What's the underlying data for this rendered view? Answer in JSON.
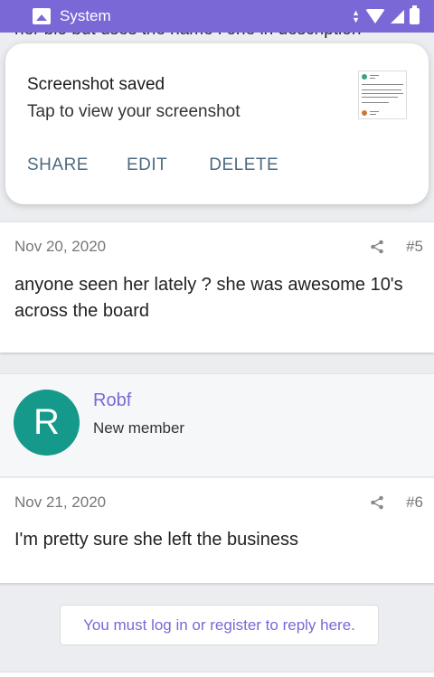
{
  "status_bar": {
    "app_name": "System",
    "icons": [
      "image-icon",
      "data-arrows-icon",
      "wifi-icon",
      "signal-icon",
      "battery-icon"
    ]
  },
  "clipped_text": "her bio but uses the name i one in description",
  "notification": {
    "title": "Screenshot saved",
    "subtitle": "Tap to view your screenshot",
    "actions": {
      "share": "SHARE",
      "edit": "EDIT",
      "delete": "DELETE"
    }
  },
  "posts": [
    {
      "date": "Nov 20, 2020",
      "number": "#5",
      "body": "anyone seen her lately ? she was awesome 10's across the board"
    },
    {
      "date": "Nov 21, 2020",
      "number": "#6",
      "body": "I'm pretty sure she left the business"
    }
  ],
  "member": {
    "avatar_letter": "R",
    "name": "Robf",
    "role": "New member"
  },
  "reply_prompt": "You must log in or register to reply here.",
  "colors": {
    "accent": "#7a68d6",
    "avatar": "#14998a",
    "action_text": "#4c6a80"
  }
}
